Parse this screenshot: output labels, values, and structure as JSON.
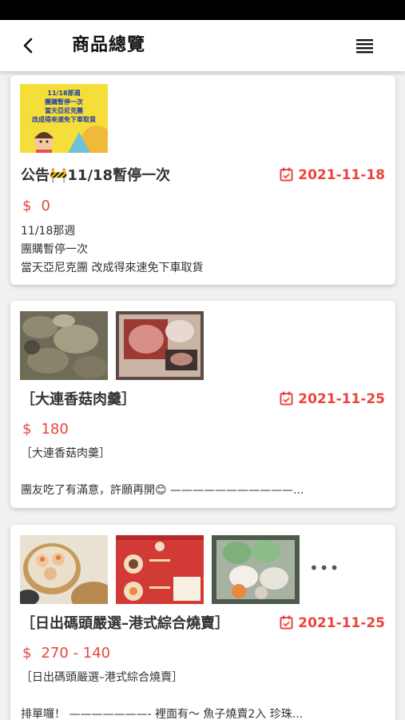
{
  "header": {
    "title": "商品總覽",
    "back_icon": "chevron-left-icon",
    "menu_icon": "hamburger-menu-icon"
  },
  "colors": {
    "accent": "#e8453c",
    "text": "#333333",
    "background": "#f1f1f1"
  },
  "products": [
    {
      "title": "公告🚧11/18暫停一次",
      "date": "2021-11-18",
      "currency": "$",
      "price": "0",
      "thumbnail_text": [
        "11/18那週",
        "團購暫停一次",
        "當天亞尼克團",
        "改成得來速免下車取貨"
      ],
      "description": [
        "11/18那週",
        "團購暫停一次",
        "當天亞尼克團  改成得來速免下車取貨"
      ]
    },
    {
      "title": "［大連香菇肉羹］",
      "date": "2021-11-25",
      "currency": "$",
      "price": "180",
      "description": [
        "［大連香菇肉羹］",
        "",
        "團友吃了有滿意，許願再開😊    ———————————..."
      ]
    },
    {
      "title": "［日出碼頭嚴選–港式綜合燒賣］",
      "date": "2021-11-25",
      "currency": "$",
      "price": "270 - 140",
      "more_label": "•••",
      "description": [
        "［日出碼頭嚴選–港式綜合燒賣］",
        "",
        "排單囉！     ———————-  裡面有～    魚子燒賣2入  珍珠..."
      ]
    }
  ]
}
